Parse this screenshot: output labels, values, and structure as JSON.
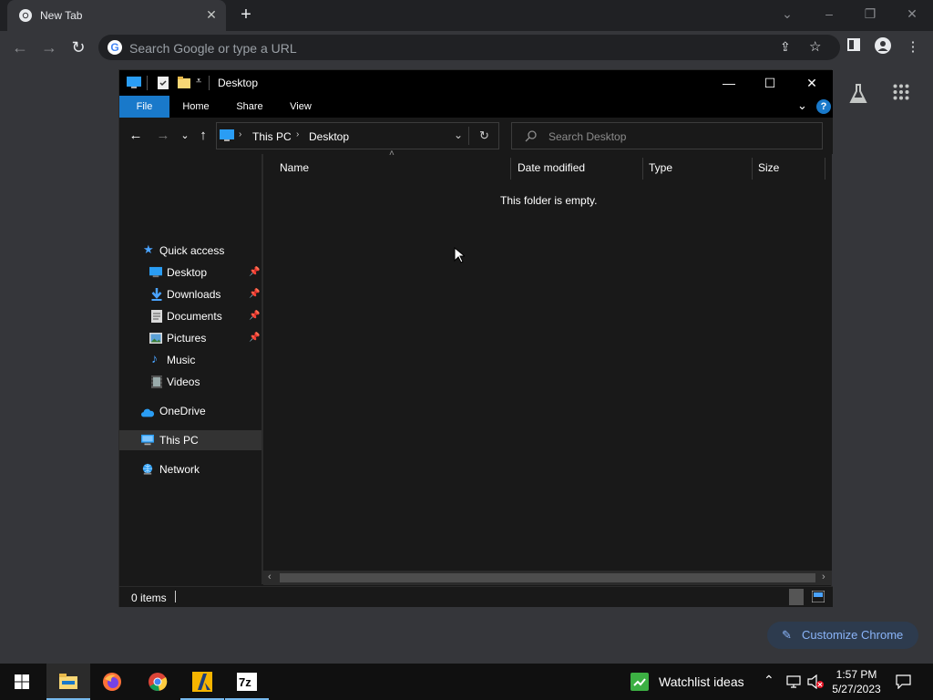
{
  "browser": {
    "tab_title": "New Tab",
    "omnibox_placeholder": "Search Google or type a URL",
    "customize_label": "Customize Chrome"
  },
  "explorer": {
    "window_title": "Desktop",
    "ribbon_tabs": [
      "File",
      "Home",
      "Share",
      "View"
    ],
    "breadcrumb": [
      "This PC",
      "Desktop"
    ],
    "search_placeholder": "Search Desktop",
    "nav": {
      "quick_access": "Quick access",
      "pinned": [
        "Desktop",
        "Downloads",
        "Documents",
        "Pictures"
      ],
      "unpinned": [
        "Music",
        "Videos"
      ],
      "onedrive": "OneDrive",
      "this_pc": "This PC",
      "network": "Network"
    },
    "columns": [
      "Name",
      "Date modified",
      "Type",
      "Size"
    ],
    "empty_message": "This folder is empty.",
    "status_items": "0 items"
  },
  "taskbar": {
    "watchlist_label": "Watchlist ideas",
    "time": "1:57 PM",
    "date": "5/27/2023"
  },
  "colors": {
    "explorer_accent": "#1979ca",
    "chrome_link": "#8ab4f8"
  }
}
